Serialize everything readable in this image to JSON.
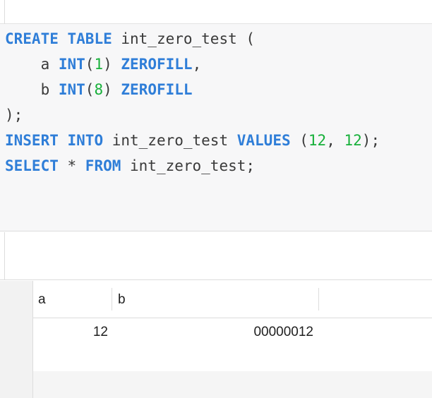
{
  "editor": {
    "lines": [
      [
        {
          "t": "CREATE",
          "c": "kw"
        },
        {
          "t": " "
        },
        {
          "t": "TABLE",
          "c": "kw"
        },
        {
          "t": " int_zero_test ("
        }
      ],
      [
        {
          "t": "    a "
        },
        {
          "t": "INT",
          "c": "kw"
        },
        {
          "t": "("
        },
        {
          "t": "1",
          "c": "num"
        },
        {
          "t": ") "
        },
        {
          "t": "ZEROFILL",
          "c": "kw"
        },
        {
          "t": ","
        }
      ],
      [
        {
          "t": "    b "
        },
        {
          "t": "INT",
          "c": "kw"
        },
        {
          "t": "("
        },
        {
          "t": "8",
          "c": "num"
        },
        {
          "t": ") "
        },
        {
          "t": "ZEROFILL",
          "c": "kw"
        }
      ],
      [
        {
          "t": ");"
        }
      ],
      [
        {
          "t": "INSERT",
          "c": "kw"
        },
        {
          "t": " "
        },
        {
          "t": "INTO",
          "c": "kw"
        },
        {
          "t": " int_zero_test "
        },
        {
          "t": "VALUES",
          "c": "kw"
        },
        {
          "t": " ("
        },
        {
          "t": "12",
          "c": "num"
        },
        {
          "t": ", "
        },
        {
          "t": "12",
          "c": "num"
        },
        {
          "t": ");"
        }
      ],
      [
        {
          "t": "SELECT",
          "c": "kw"
        },
        {
          "t": " * "
        },
        {
          "t": "FROM",
          "c": "kw"
        },
        {
          "t": " int_zero_test;"
        }
      ]
    ]
  },
  "results": {
    "columns": [
      "a",
      "b"
    ],
    "rows": [
      [
        "12",
        "00000012"
      ]
    ]
  },
  "colors": {
    "keyword": "#2f7ed8",
    "number": "#17b03a",
    "text": "#3a3a3a"
  }
}
